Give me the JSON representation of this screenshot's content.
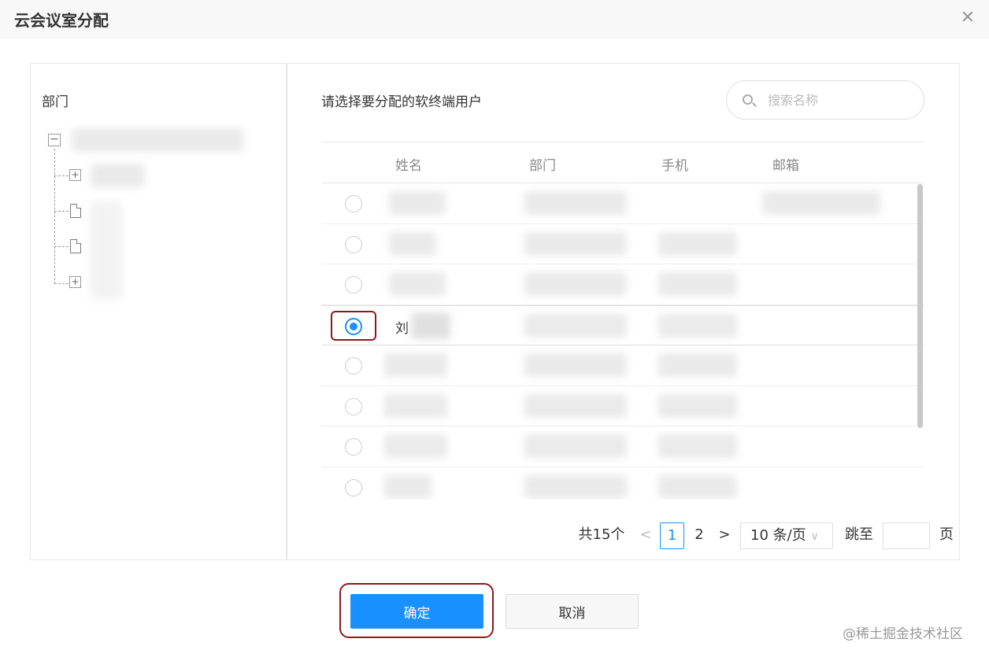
{
  "dialog": {
    "title": "云会议室分配",
    "close_glyph": "✕"
  },
  "tree": {
    "label": "部门",
    "root_toggle": "−",
    "expand_glyph": "+"
  },
  "main": {
    "prompt": "请选择要分配的软终端用户",
    "search": {
      "placeholder": "搜索名称"
    }
  },
  "table": {
    "columns": [
      "姓名",
      "部门",
      "手机",
      "邮箱"
    ],
    "rows": [
      {
        "name": "",
        "selected": false
      },
      {
        "name": "",
        "selected": false
      },
      {
        "name": "",
        "selected": false
      },
      {
        "name": "刘",
        "selected": true
      },
      {
        "name": "",
        "selected": false
      },
      {
        "name": "",
        "selected": false
      },
      {
        "name": "",
        "selected": false
      },
      {
        "name": "",
        "selected": false
      }
    ]
  },
  "pagination": {
    "total": "共15个",
    "prev_glyph": "<",
    "pages": [
      "1",
      "2"
    ],
    "next_glyph": ">",
    "page_size": "10 条/页",
    "select_caret": "∨",
    "jump_label": "跳至",
    "page_suffix": "页"
  },
  "footer": {
    "ok_label": "确定",
    "cancel_label": "取消"
  },
  "watermark": "@稀土掘金技术社区",
  "colors": {
    "accent": "#1890ff",
    "highlight": "#8b1a1a"
  }
}
